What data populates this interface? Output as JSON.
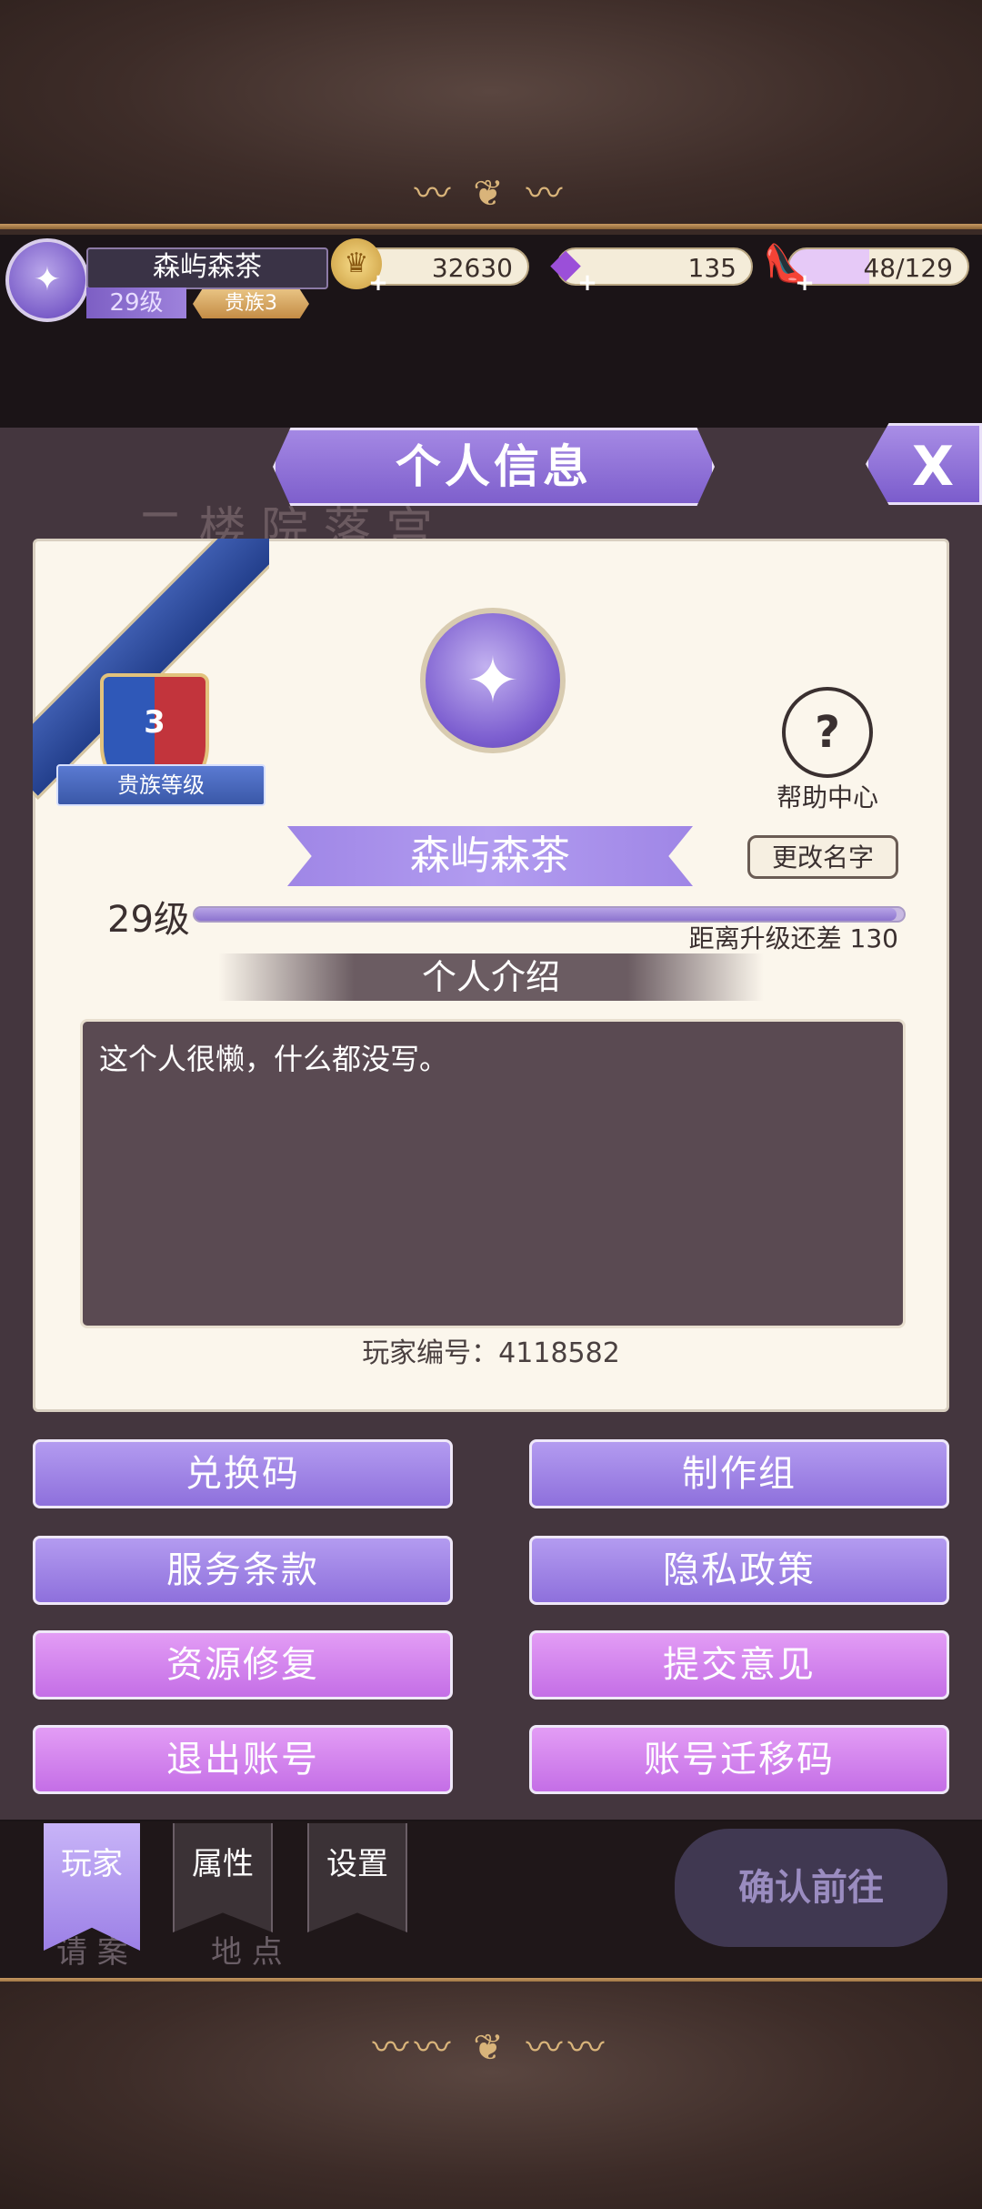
{
  "header": {
    "player_name": "森屿森茶",
    "level_label": "29级",
    "noble_label": "贵族3",
    "gold": "32630",
    "diamonds": "135",
    "stamina": "48/129",
    "plus_glyph": "+"
  },
  "panel": {
    "title": "个人信息",
    "close_label": "X",
    "noble_rank": "3",
    "noble_rank_label": "贵族等级",
    "help_icon_glyph": "?",
    "help_label": "帮助中心",
    "avatar_glyph": "✦",
    "player_name": "森屿森茶",
    "rename_label": "更改名字",
    "level": "29级",
    "exp_progress": 0.99,
    "exp_remaining_text": "距离升级还差 130",
    "intro_heading": "个人介绍",
    "intro_text": "这个人很懒，什么都没写。",
    "player_id_text": "玩家编号：4118582"
  },
  "buttons": [
    {
      "label": "兑换码",
      "style": "violet"
    },
    {
      "label": "制作组",
      "style": "violet"
    },
    {
      "label": "服务条款",
      "style": "violet"
    },
    {
      "label": "隐私政策",
      "style": "violet"
    },
    {
      "label": "资源修复",
      "style": "pink"
    },
    {
      "label": "提交意见",
      "style": "pink"
    },
    {
      "label": "退出账号",
      "style": "pink"
    },
    {
      "label": "账号迁移码",
      "style": "pink"
    }
  ],
  "tabs": [
    {
      "label": "玩家",
      "active": true
    },
    {
      "label": "属性",
      "active": false
    },
    {
      "label": "设置",
      "active": false
    }
  ],
  "background": {
    "confirm_label": "确认前往",
    "ghost_left": "请 案",
    "ghost_right": "地 点"
  },
  "colors": {
    "accent_violet": "#9f86e6",
    "accent_pink": "#d486ee",
    "panel_bg": "#fbf6ec",
    "intro_bg": "#5a4a52"
  },
  "icons": {
    "gold": "crown-coin-icon",
    "diamond": "purple-gem-icon",
    "stamina": "glass-slipper-icon",
    "help": "help-book-icon",
    "close": "close-icon"
  }
}
